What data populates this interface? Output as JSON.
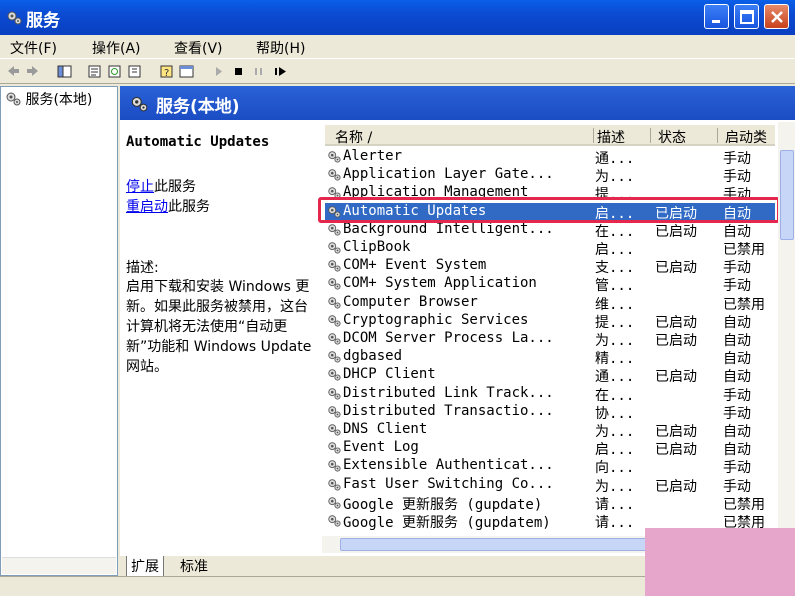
{
  "window": {
    "title": "服务"
  },
  "menu": [
    {
      "label": "文件(F)"
    },
    {
      "label": "操作(A)"
    },
    {
      "label": "查看(V)"
    },
    {
      "label": "帮助(H)"
    }
  ],
  "tree": {
    "root_label": "服务(本地)"
  },
  "header": {
    "title": "服务(本地)"
  },
  "extended": {
    "service_name": "Automatic Updates",
    "stop_link": "停止",
    "stop_suffix": "此服务",
    "restart_link": "重启动",
    "restart_suffix": "此服务",
    "desc_label": "描述:",
    "desc_text": "启用下载和安装 Windows 更新。如果此服务被禁用，这台计算机将无法使用“自动更新”功能和 Windows Update 网站。"
  },
  "list": {
    "columns": {
      "name": "名称 /",
      "desc": "描述",
      "status": "状态",
      "startup": "启动类"
    },
    "rows": [
      {
        "name": "Alerter",
        "desc": "通...",
        "status": "",
        "startup": "手动"
      },
      {
        "name": "Application Layer Gate...",
        "desc": "为...",
        "status": "",
        "startup": "手动"
      },
      {
        "name": "Application Management",
        "desc": "提...",
        "status": "",
        "startup": "手动"
      },
      {
        "name": "Automatic Updates",
        "desc": "启...",
        "status": "已启动",
        "startup": "自动",
        "selected": true
      },
      {
        "name": "Background Intelligent...",
        "desc": "在...",
        "status": "已启动",
        "startup": "自动"
      },
      {
        "name": "ClipBook",
        "desc": "启...",
        "status": "",
        "startup": "已禁用"
      },
      {
        "name": "COM+ Event System",
        "desc": "支...",
        "status": "已启动",
        "startup": "手动"
      },
      {
        "name": "COM+ System Application",
        "desc": "管...",
        "status": "",
        "startup": "手动"
      },
      {
        "name": "Computer Browser",
        "desc": "维...",
        "status": "",
        "startup": "已禁用"
      },
      {
        "name": "Cryptographic Services",
        "desc": "提...",
        "status": "已启动",
        "startup": "自动"
      },
      {
        "name": "DCOM Server Process La...",
        "desc": "为...",
        "status": "已启动",
        "startup": "自动"
      },
      {
        "name": "dgbased",
        "desc": "精...",
        "status": "",
        "startup": "自动"
      },
      {
        "name": "DHCP Client",
        "desc": "通...",
        "status": "已启动",
        "startup": "自动"
      },
      {
        "name": "Distributed Link Track...",
        "desc": "在...",
        "status": "",
        "startup": "手动"
      },
      {
        "name": "Distributed Transactio...",
        "desc": "协...",
        "status": "",
        "startup": "手动"
      },
      {
        "name": "DNS Client",
        "desc": "为...",
        "status": "已启动",
        "startup": "自动"
      },
      {
        "name": "Event Log",
        "desc": "启...",
        "status": "已启动",
        "startup": "自动"
      },
      {
        "name": "Extensible Authenticat...",
        "desc": "向...",
        "status": "",
        "startup": "手动"
      },
      {
        "name": "Fast User Switching Co...",
        "desc": "为...",
        "status": "已启动",
        "startup": "手动"
      },
      {
        "name": "Google 更新服务 (gupdate)",
        "desc": "请...",
        "status": "",
        "startup": "已禁用"
      },
      {
        "name": "Google 更新服务 (gupdatem)",
        "desc": "请...",
        "status": "",
        "startup": "已禁用"
      }
    ]
  },
  "tabs": [
    {
      "label": "扩展"
    },
    {
      "label": "标准"
    }
  ],
  "colors": {
    "title_blue": "#0b4bd2",
    "selection": "#316ac5",
    "highlight_border": "#e5264d"
  }
}
